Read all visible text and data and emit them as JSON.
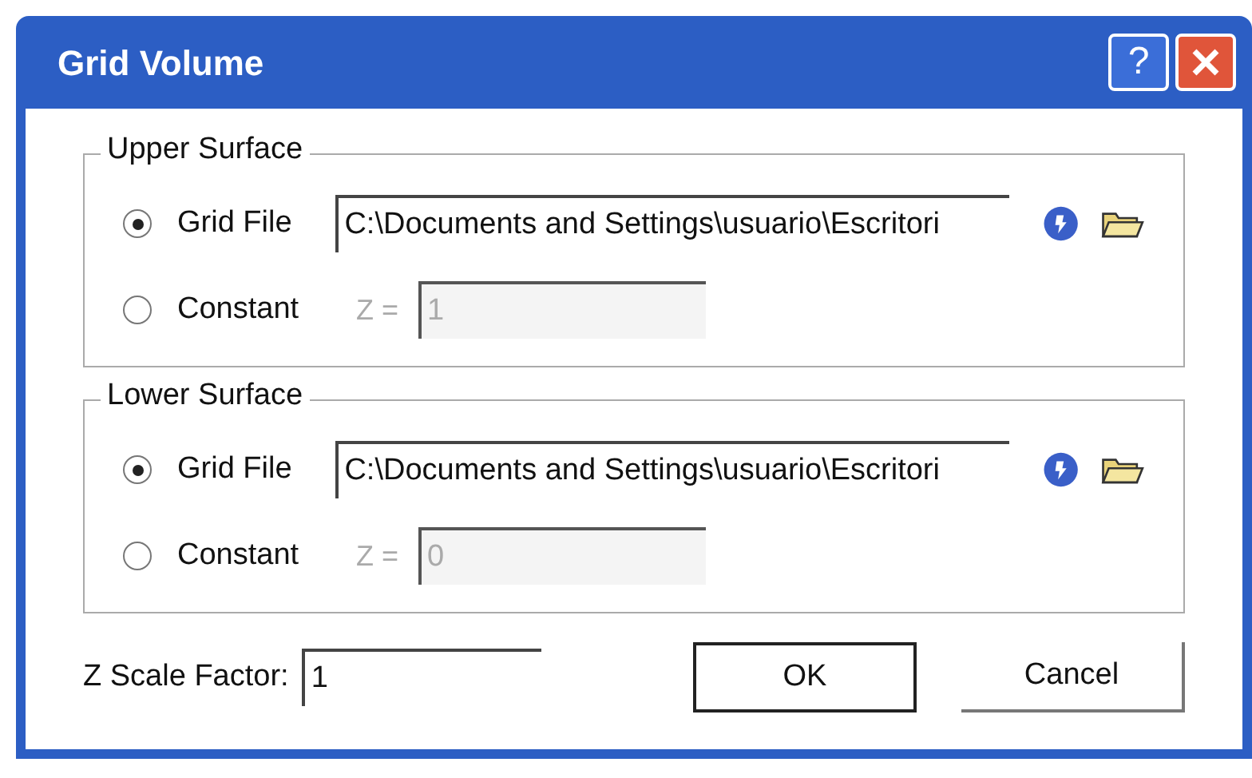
{
  "window": {
    "title": "Grid Volume",
    "help_label": "?"
  },
  "surfaces": [
    {
      "title": "Upper Surface",
      "options": [
        {
          "kind": "file",
          "label": "Grid File",
          "selected": true,
          "value": "C:\\Documents and Settings\\usuario\\Escritori"
        },
        {
          "kind": "constant",
          "label": "Constant",
          "selected": false,
          "prefix": "Z =",
          "value": "1",
          "disabled": true
        }
      ]
    },
    {
      "title": "Lower Surface",
      "options": [
        {
          "kind": "file",
          "label": "Grid File",
          "selected": true,
          "value": "C:\\Documents and Settings\\usuario\\Escritori"
        },
        {
          "kind": "constant",
          "label": "Constant",
          "selected": false,
          "prefix": "Z =",
          "value": "0",
          "disabled": true
        }
      ]
    }
  ],
  "scale_factor": {
    "label": "Z Scale Factor:",
    "value": "1"
  },
  "buttons": [
    {
      "label": "OK",
      "default": true
    },
    {
      "label": "Cancel",
      "default": false
    }
  ]
}
